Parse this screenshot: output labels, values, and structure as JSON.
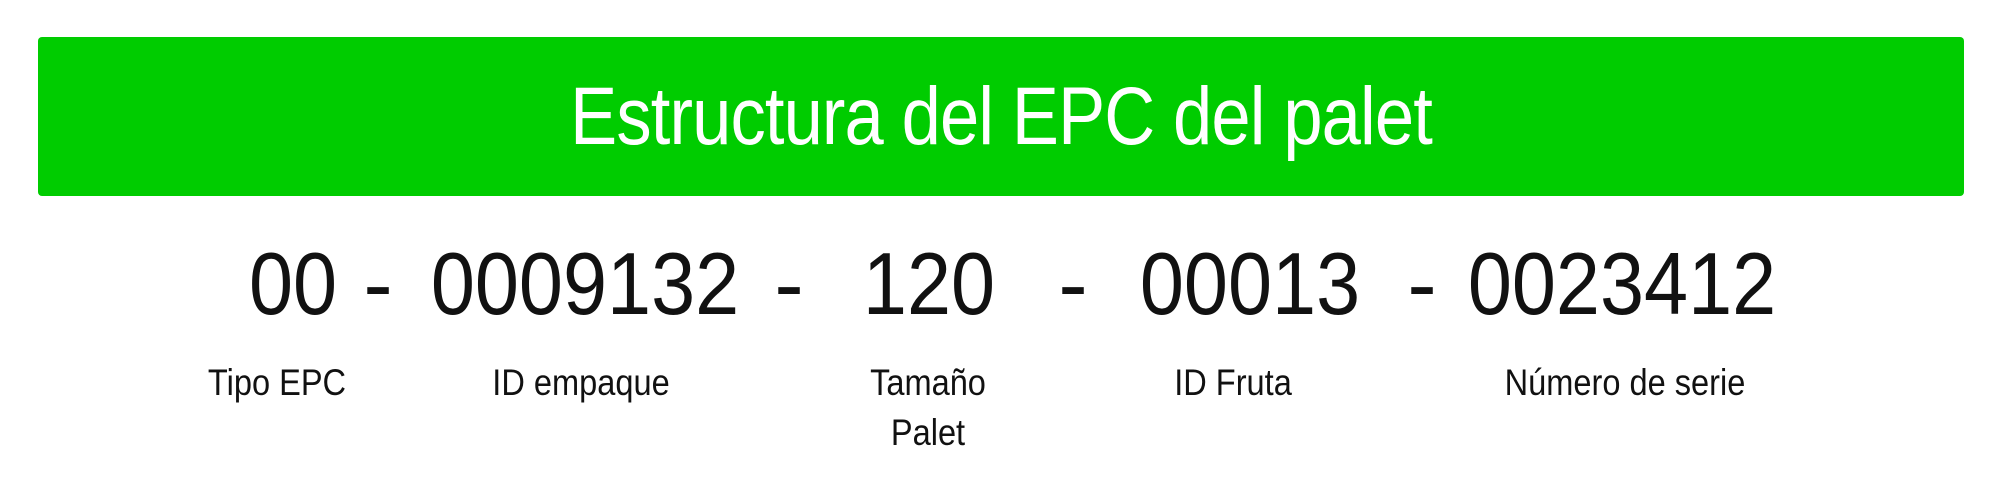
{
  "title": "Estructura del EPC del palet",
  "colors": {
    "banner": "#00cc00",
    "banner_text": "#ffffff",
    "text": "#111111"
  },
  "separator": "-",
  "segments": [
    {
      "value": "00",
      "label": "Tipo EPC"
    },
    {
      "value": "0009132",
      "label": "ID empaque"
    },
    {
      "value": "120",
      "label": "Tamaño\nPalet"
    },
    {
      "value": "00013",
      "label": "ID Fruta"
    },
    {
      "value": "0023412",
      "label": "Número de serie"
    }
  ]
}
